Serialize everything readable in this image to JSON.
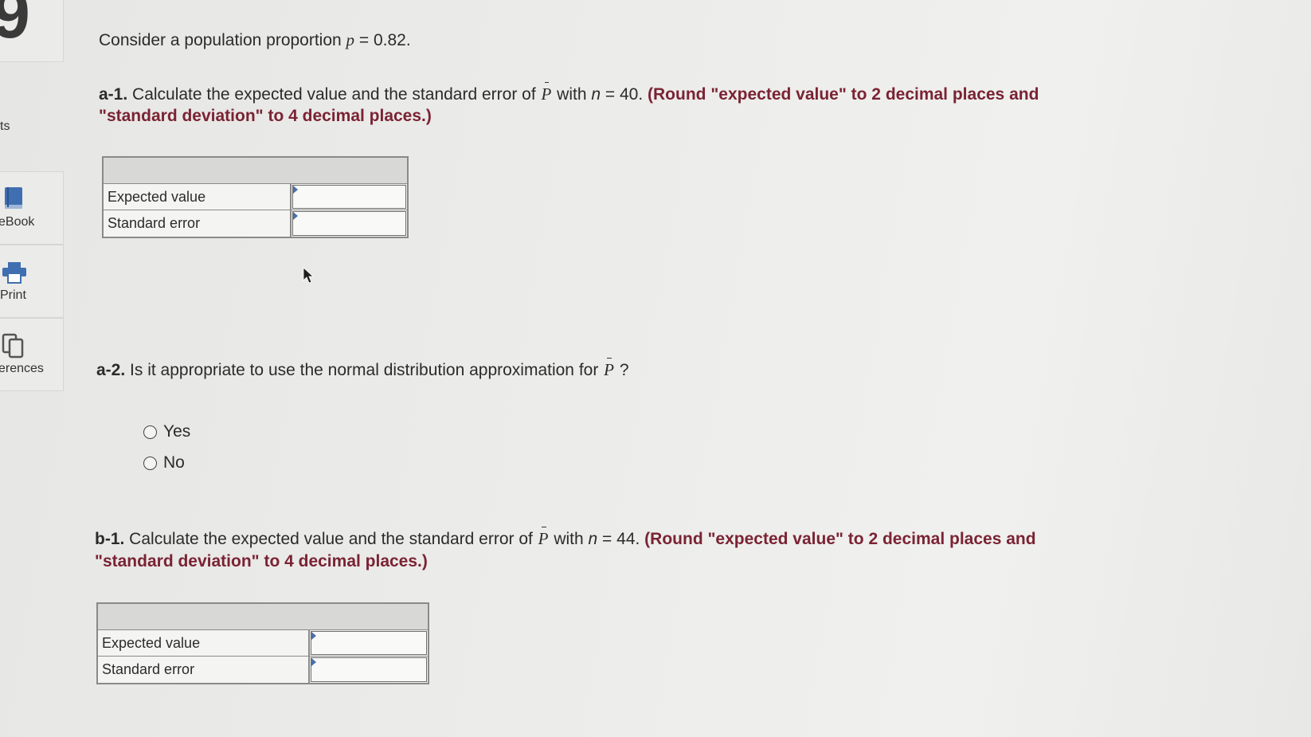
{
  "sidebar": {
    "items": [
      {
        "label": "ts",
        "icon": "text-icon"
      },
      {
        "label": "eBook",
        "icon": "book-icon"
      },
      {
        "label": "Print",
        "icon": "printer-icon"
      },
      {
        "label": "erences",
        "icon": "copy-icon"
      }
    ],
    "partial_number": "9"
  },
  "intro": {
    "text_before": "Consider a population proportion ",
    "var": "p",
    "text_after": " = 0.82."
  },
  "a1": {
    "label": "a-1.",
    "text1": " Calculate the expected value and the standard error of ",
    "var": "P",
    "text2": " with ",
    "n_var": "n",
    "n_text": " = 40. ",
    "instruction_line1": "(Round \"expected value\" to 2 decimal places and",
    "instruction_line2": "\"standard deviation\" to 4 decimal places.)",
    "rows": [
      {
        "label": "Expected value",
        "value": ""
      },
      {
        "label": "Standard error",
        "value": ""
      }
    ]
  },
  "a2": {
    "label": "a-2.",
    "text": " Is it appropriate to use the normal distribution approximation for ",
    "var": "P",
    "end": " ?",
    "options": [
      "Yes",
      "No"
    ]
  },
  "b1": {
    "label": "b-1.",
    "text1": " Calculate the expected value and the standard error of ",
    "var": "P",
    "text2": " with ",
    "n_var": "n",
    "n_text": " = 44. ",
    "instruction_line1": "(Round \"expected value\" to 2 decimal places and",
    "instruction_line2": "\"standard deviation\" to 4 decimal places.)",
    "rows": [
      {
        "label": "Expected value",
        "value": ""
      },
      {
        "label": "Standard error",
        "value": ""
      }
    ]
  },
  "colors": {
    "instruction": "#7a2333",
    "table_header": "#d8d8d6",
    "input_marker": "#4a6fa8"
  }
}
